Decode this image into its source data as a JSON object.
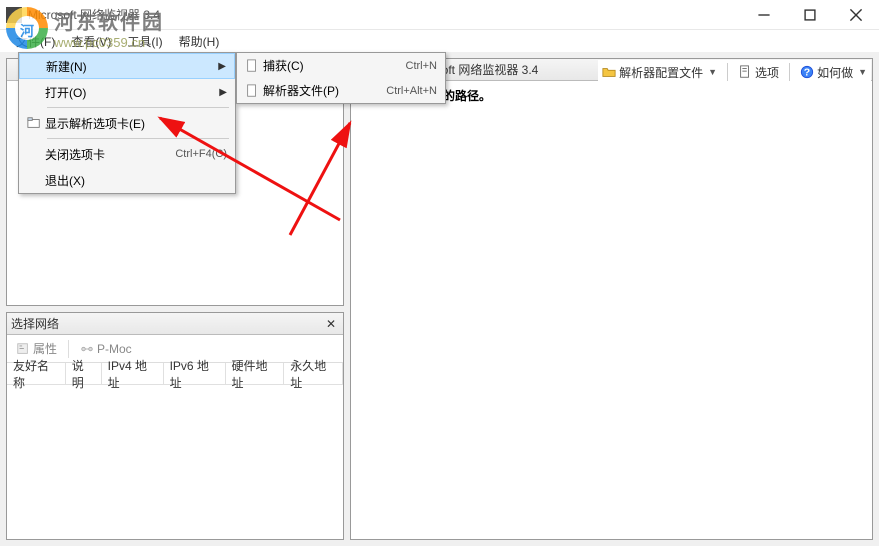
{
  "window": {
    "title": "Microsoft 网络监视器 3.4"
  },
  "menubar": {
    "file": "文件(F)",
    "view": "查看(V)",
    "tools": "工具(I)",
    "help": "帮助(H)"
  },
  "toolbar": {
    "parser_profile": "解析器配置文件",
    "options": "选项",
    "howto": "如何做"
  },
  "file_menu": {
    "new": "新建(N)",
    "open": "打开(O)",
    "show_parsing_tab": "显示解析选项卡(E)",
    "close_tab": "关闭选项卡",
    "close_tab_accel": "Ctrl+F4(C)",
    "exit": "退出(X)"
  },
  "sub_menu": {
    "capture": "捕获(C)",
    "capture_accel": "Ctrl+N",
    "parser_file": "解析器文件(P)",
    "parser_file_accel": "Ctrl+Alt+N"
  },
  "left_panel": {
    "select_network": "选择网络",
    "props": "属性",
    "pmode": "P-Moc",
    "cols": [
      "友好名称",
      "说明",
      "IPv4 地址",
      "IPv6 地址",
      "硬件地址",
      "永久地址"
    ]
  },
  "right_panel": {
    "title": "开始使用 Microsoft 网络监视器 3.4",
    "body": "系统找不到指定的路径。"
  },
  "watermark": {
    "name": "河东软件园",
    "url": "www.pc0359.cn"
  }
}
